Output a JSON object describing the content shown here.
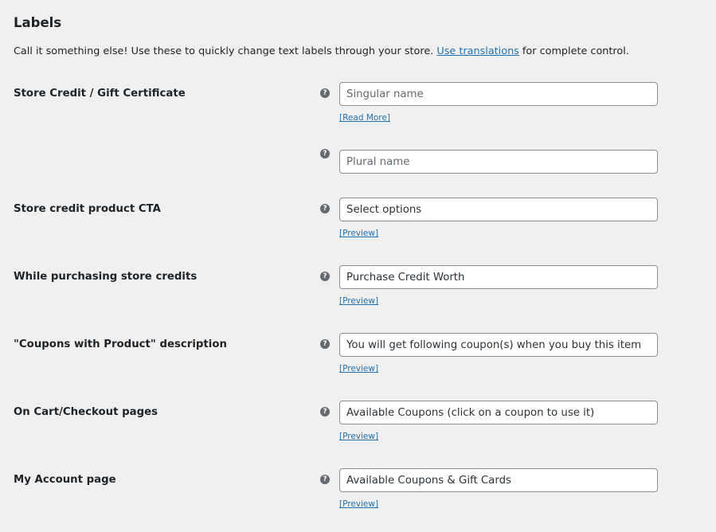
{
  "section": {
    "title": "Labels",
    "description_before": "Call it something else! Use these to quickly change text labels through your store. ",
    "description_link": "Use translations",
    "description_after": " for complete control."
  },
  "help_icon_glyph": "?",
  "rows": [
    {
      "label": "Store Credit / Gift Certificate",
      "input_value": "",
      "input_placeholder": "Singular name",
      "link": "[Read More]"
    },
    {
      "label": "",
      "input_value": "",
      "input_placeholder": "Plural name",
      "link": ""
    },
    {
      "label": "Store credit product CTA",
      "input_value": "Select options",
      "input_placeholder": "",
      "link": "[Preview]"
    },
    {
      "label": "While purchasing store credits",
      "input_value": "Purchase Credit Worth",
      "input_placeholder": "",
      "link": "[Preview]"
    },
    {
      "label": "\"Coupons with Product\" description",
      "input_value": "You will get following coupon(s) when you buy this item",
      "input_placeholder": "",
      "link": "[Preview]"
    },
    {
      "label": "On Cart/Checkout pages",
      "input_value": "Available Coupons (click on a coupon to use it)",
      "input_placeholder": "",
      "link": "[Preview]"
    },
    {
      "label": "My Account page",
      "input_value": "Available Coupons & Gift Cards",
      "input_placeholder": "",
      "link": "[Preview]"
    }
  ],
  "colors": {
    "background": "#f0f0f1",
    "link": "#2271b1",
    "text": "#1d2327",
    "help_icon": "#646970",
    "input_border": "#8c8f94"
  }
}
